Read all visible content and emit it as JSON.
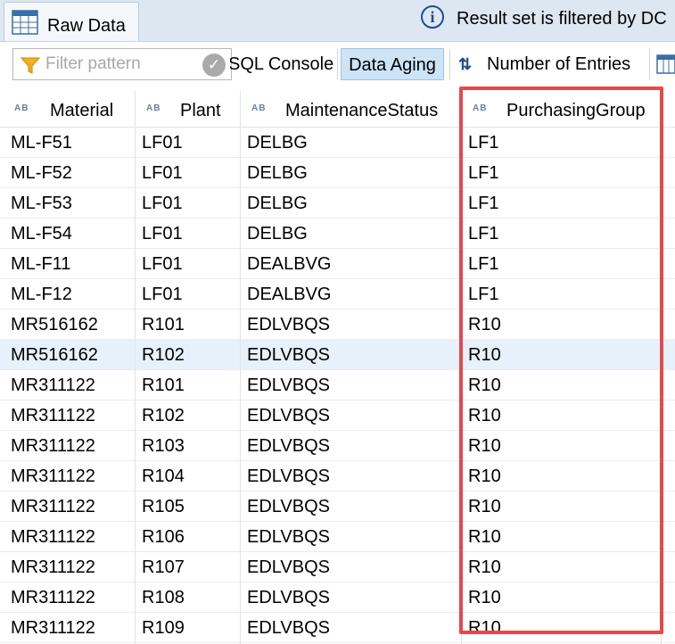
{
  "tab": {
    "label": "Raw Data"
  },
  "info": {
    "message": "Result set is filtered by DC"
  },
  "toolbar": {
    "filter_placeholder": "Filter pattern",
    "sql_console": "SQL Console",
    "data_aging": "Data Aging",
    "number_of_entries": "Number of Entries"
  },
  "columns": [
    {
      "type_badge": "AB",
      "label": "Material"
    },
    {
      "type_badge": "AB",
      "label": "Plant"
    },
    {
      "type_badge": "AB",
      "label": "MaintenanceStatus"
    },
    {
      "type_badge": "AB",
      "label": "PurchasingGroup"
    }
  ],
  "rows": [
    [
      "ML-F51",
      "LF01",
      "DELBG",
      "LF1"
    ],
    [
      "ML-F52",
      "LF01",
      "DELBG",
      "LF1"
    ],
    [
      "ML-F53",
      "LF01",
      "DELBG",
      "LF1"
    ],
    [
      "ML-F54",
      "LF01",
      "DELBG",
      "LF1"
    ],
    [
      "ML-F11",
      "LF01",
      "DEALBVG",
      "LF1"
    ],
    [
      "ML-F12",
      "LF01",
      "DEALBVG",
      "LF1"
    ],
    [
      "MR516162",
      "R101",
      "EDLVBQS",
      "R10"
    ],
    [
      "MR516162",
      "R102",
      "EDLVBQS",
      "R10"
    ],
    [
      "MR311122",
      "R101",
      "EDLVBQS",
      "R10"
    ],
    [
      "MR311122",
      "R102",
      "EDLVBQS",
      "R10"
    ],
    [
      "MR311122",
      "R103",
      "EDLVBQS",
      "R10"
    ],
    [
      "MR311122",
      "R104",
      "EDLVBQS",
      "R10"
    ],
    [
      "MR311122",
      "R105",
      "EDLVBQS",
      "R10"
    ],
    [
      "MR311122",
      "R106",
      "EDLVBQS",
      "R10"
    ],
    [
      "MR311122",
      "R107",
      "EDLVBQS",
      "R10"
    ],
    [
      "MR311122",
      "R108",
      "EDLVBQS",
      "R10"
    ],
    [
      "MR311122",
      "R109",
      "EDLVBQS",
      "R10"
    ]
  ],
  "selected_row_index": 7,
  "colors": {
    "highlight": "#e5484d",
    "selection": "#e6f1fb",
    "active_button": "#cde3f6"
  }
}
